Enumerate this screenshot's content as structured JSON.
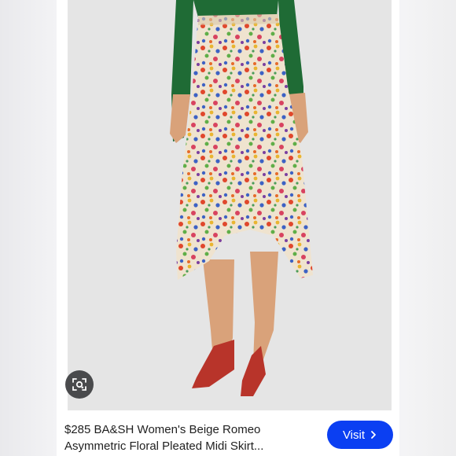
{
  "result": {
    "title_line1": "$285 BA&SH Women's Beige Romeo",
    "title_line2": "Asymmetric Floral Pleated Midi Skirt..."
  },
  "visit_button": {
    "label": "Visit",
    "icon": "chevron-right-icon"
  },
  "lens_button": {
    "icon": "image-search-icon"
  },
  "colors": {
    "accent": "#0b3ff2",
    "sweater": "#1f6b35",
    "shoes": "#b8342a",
    "skin": "#d9a27a",
    "skirt_base": "#efe3cf"
  }
}
